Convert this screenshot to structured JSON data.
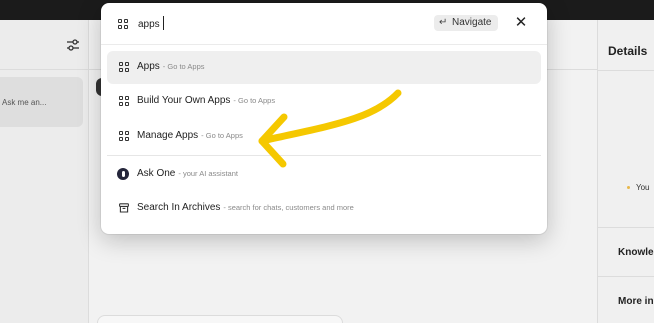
{
  "background": {
    "left_panel": {
      "ask_text": "Ask me an..."
    },
    "right_panel": {
      "title": "Details",
      "you_label": "You",
      "knowledge_label": "Knowle",
      "more_info_label": "More in"
    }
  },
  "palette": {
    "search": {
      "value": "apps",
      "placeholder": ""
    },
    "navigate_label": "Navigate",
    "enter_symbol": "↵",
    "close_symbol": "✕",
    "items": [
      {
        "label": "Apps",
        "hint": "- Go to Apps",
        "icon": "apps-grid-icon",
        "selected": true
      },
      {
        "label": "Build Your Own Apps",
        "hint": "- Go to Apps",
        "icon": "apps-grid-icon"
      },
      {
        "label": "Manage Apps",
        "hint": "- Go to Apps",
        "icon": "apps-grid-icon"
      },
      {
        "label": "Ask One",
        "hint": "- your AI assistant",
        "icon": "ai-assistant-icon"
      },
      {
        "label": "Search In Archives",
        "hint": "- search for chats, customers and more",
        "icon": "archive-icon"
      }
    ]
  },
  "annotation": {
    "arrow_color": "#f5c800"
  }
}
